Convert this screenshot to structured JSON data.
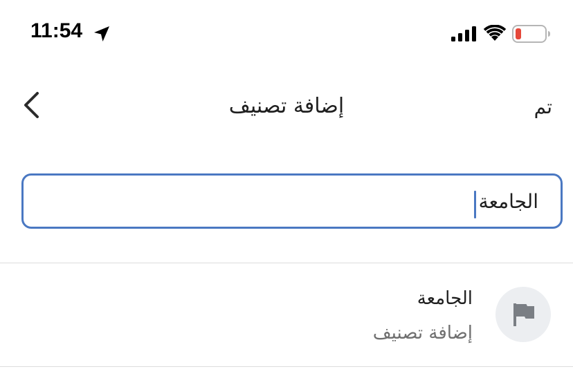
{
  "status_bar": {
    "time": "11:54",
    "icons": [
      "location-arrow-icon",
      "signal-bars-icon",
      "wifi-icon",
      "battery-low-icon"
    ],
    "battery_color": "#e5483a"
  },
  "header": {
    "title": "إضافة تصنيف",
    "done_label": "تم",
    "back_icon": "chevron-left-icon"
  },
  "input": {
    "value": "الجامعة",
    "border_color": "#4a78c2"
  },
  "suggestion": {
    "icon": "flag-icon",
    "title": "الجامعة",
    "subtitle": "إضافة تصنيف"
  }
}
